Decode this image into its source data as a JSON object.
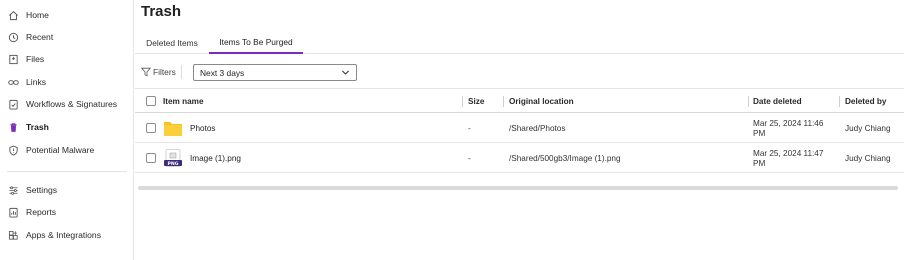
{
  "sidebar": {
    "items": [
      {
        "label": "Home",
        "icon": "home-icon"
      },
      {
        "label": "Recent",
        "icon": "clock-icon"
      },
      {
        "label": "Files",
        "icon": "files-icon"
      },
      {
        "label": "Links",
        "icon": "link-icon"
      },
      {
        "label": "Workflows & Signatures",
        "icon": "workflow-icon"
      },
      {
        "label": "Trash",
        "icon": "trash-icon",
        "active": true
      },
      {
        "label": "Potential Malware",
        "icon": "shield-icon"
      },
      {
        "label": "Settings",
        "icon": "sliders-icon"
      },
      {
        "label": "Reports",
        "icon": "report-icon"
      },
      {
        "label": "Apps & Integrations",
        "icon": "apps-icon"
      }
    ]
  },
  "page": {
    "title": "Trash"
  },
  "tabs": [
    {
      "label": "Deleted Items",
      "active": false
    },
    {
      "label": "Items To Be Purged",
      "active": true
    }
  ],
  "toolbar": {
    "filters_label": "Filters",
    "range_select": "Next 3 days"
  },
  "table": {
    "columns": [
      "Item name",
      "Size",
      "Original location",
      "Date deleted",
      "Deleted by"
    ],
    "rows": [
      {
        "name": "Photos",
        "type": "folder",
        "size": "-",
        "location": "/Shared/Photos",
        "date": "Mar 25, 2024 11:46 PM",
        "deleted_by": "Judy Chiang"
      },
      {
        "name": "Image (1).png",
        "type": "png",
        "thumb_label": "PNG",
        "size": "-",
        "location": "/Shared/500gb3/Image (1).png",
        "date": "Mar 25, 2024 11:47 PM",
        "deleted_by": "Judy Chiang"
      }
    ]
  },
  "colors": {
    "accent": "#7b2cbf",
    "folder": "#f9c21b",
    "png_badge": "#3c2a7a"
  }
}
